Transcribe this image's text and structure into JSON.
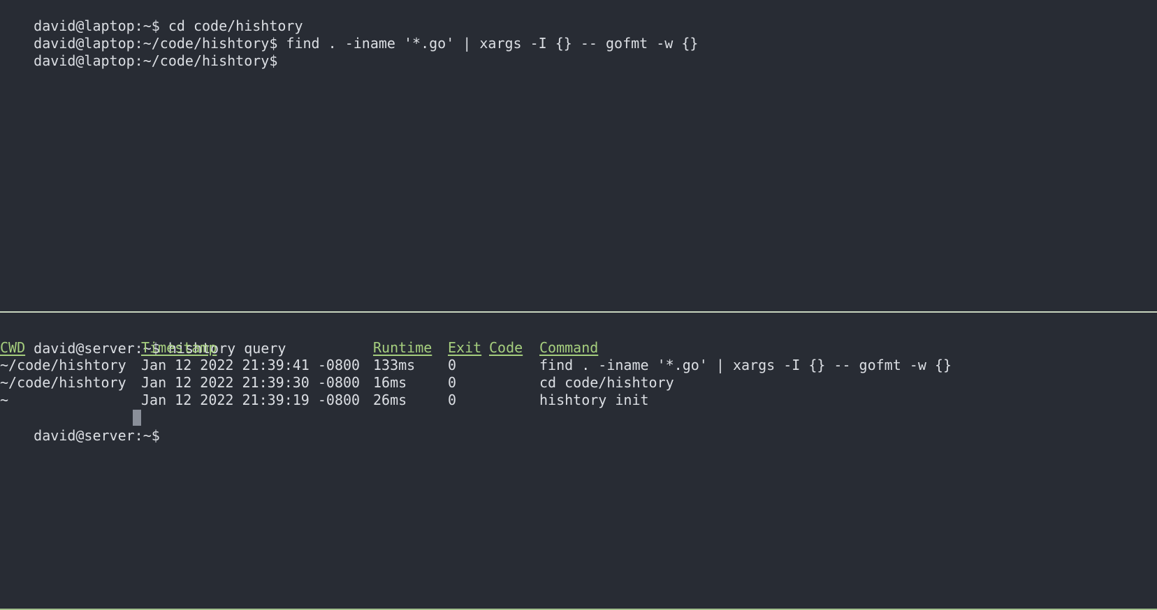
{
  "top_pane": {
    "lines": [
      {
        "prompt": "david@laptop:~$",
        "command": "cd code/hishtory"
      },
      {
        "prompt": "david@laptop:~/code/hishtory$",
        "command": "find . -iname '*.go' | xargs -I {} -- gofmt -w {}"
      },
      {
        "prompt": "david@laptop:~/code/hishtory$",
        "command": ""
      }
    ]
  },
  "bottom_pane": {
    "command_line": {
      "prompt": "david@server:~$",
      "command": "hishtory query"
    },
    "table": {
      "headers": {
        "cwd": "CWD",
        "timestamp": "Timestamp",
        "runtime": "Runtime",
        "exit": "Exit",
        "code": "Code",
        "command": "Command"
      },
      "rows": [
        {
          "cwd": "~/code/hishtory",
          "timestamp": "Jan 12 2022 21:39:41 -0800",
          "runtime": "133ms",
          "exit_code": "0",
          "command": "find . -iname '*.go' | xargs -I {} -- gofmt -w {}"
        },
        {
          "cwd": "~/code/hishtory",
          "timestamp": "Jan 12 2022 21:39:30 -0800",
          "runtime": "16ms",
          "exit_code": "0",
          "command": "cd code/hishtory"
        },
        {
          "cwd": "~",
          "timestamp": "Jan 12 2022 21:39:19 -0800",
          "runtime": "26ms",
          "exit_code": "0",
          "command": "hishtory init"
        }
      ]
    },
    "final_prompt": "david@server:~$"
  },
  "colors": {
    "background": "#282c34",
    "foreground": "#dcdfe4",
    "header_green": "#a6cf7e",
    "divider": "#c9d6bf",
    "cursor": "#8a8f99"
  }
}
